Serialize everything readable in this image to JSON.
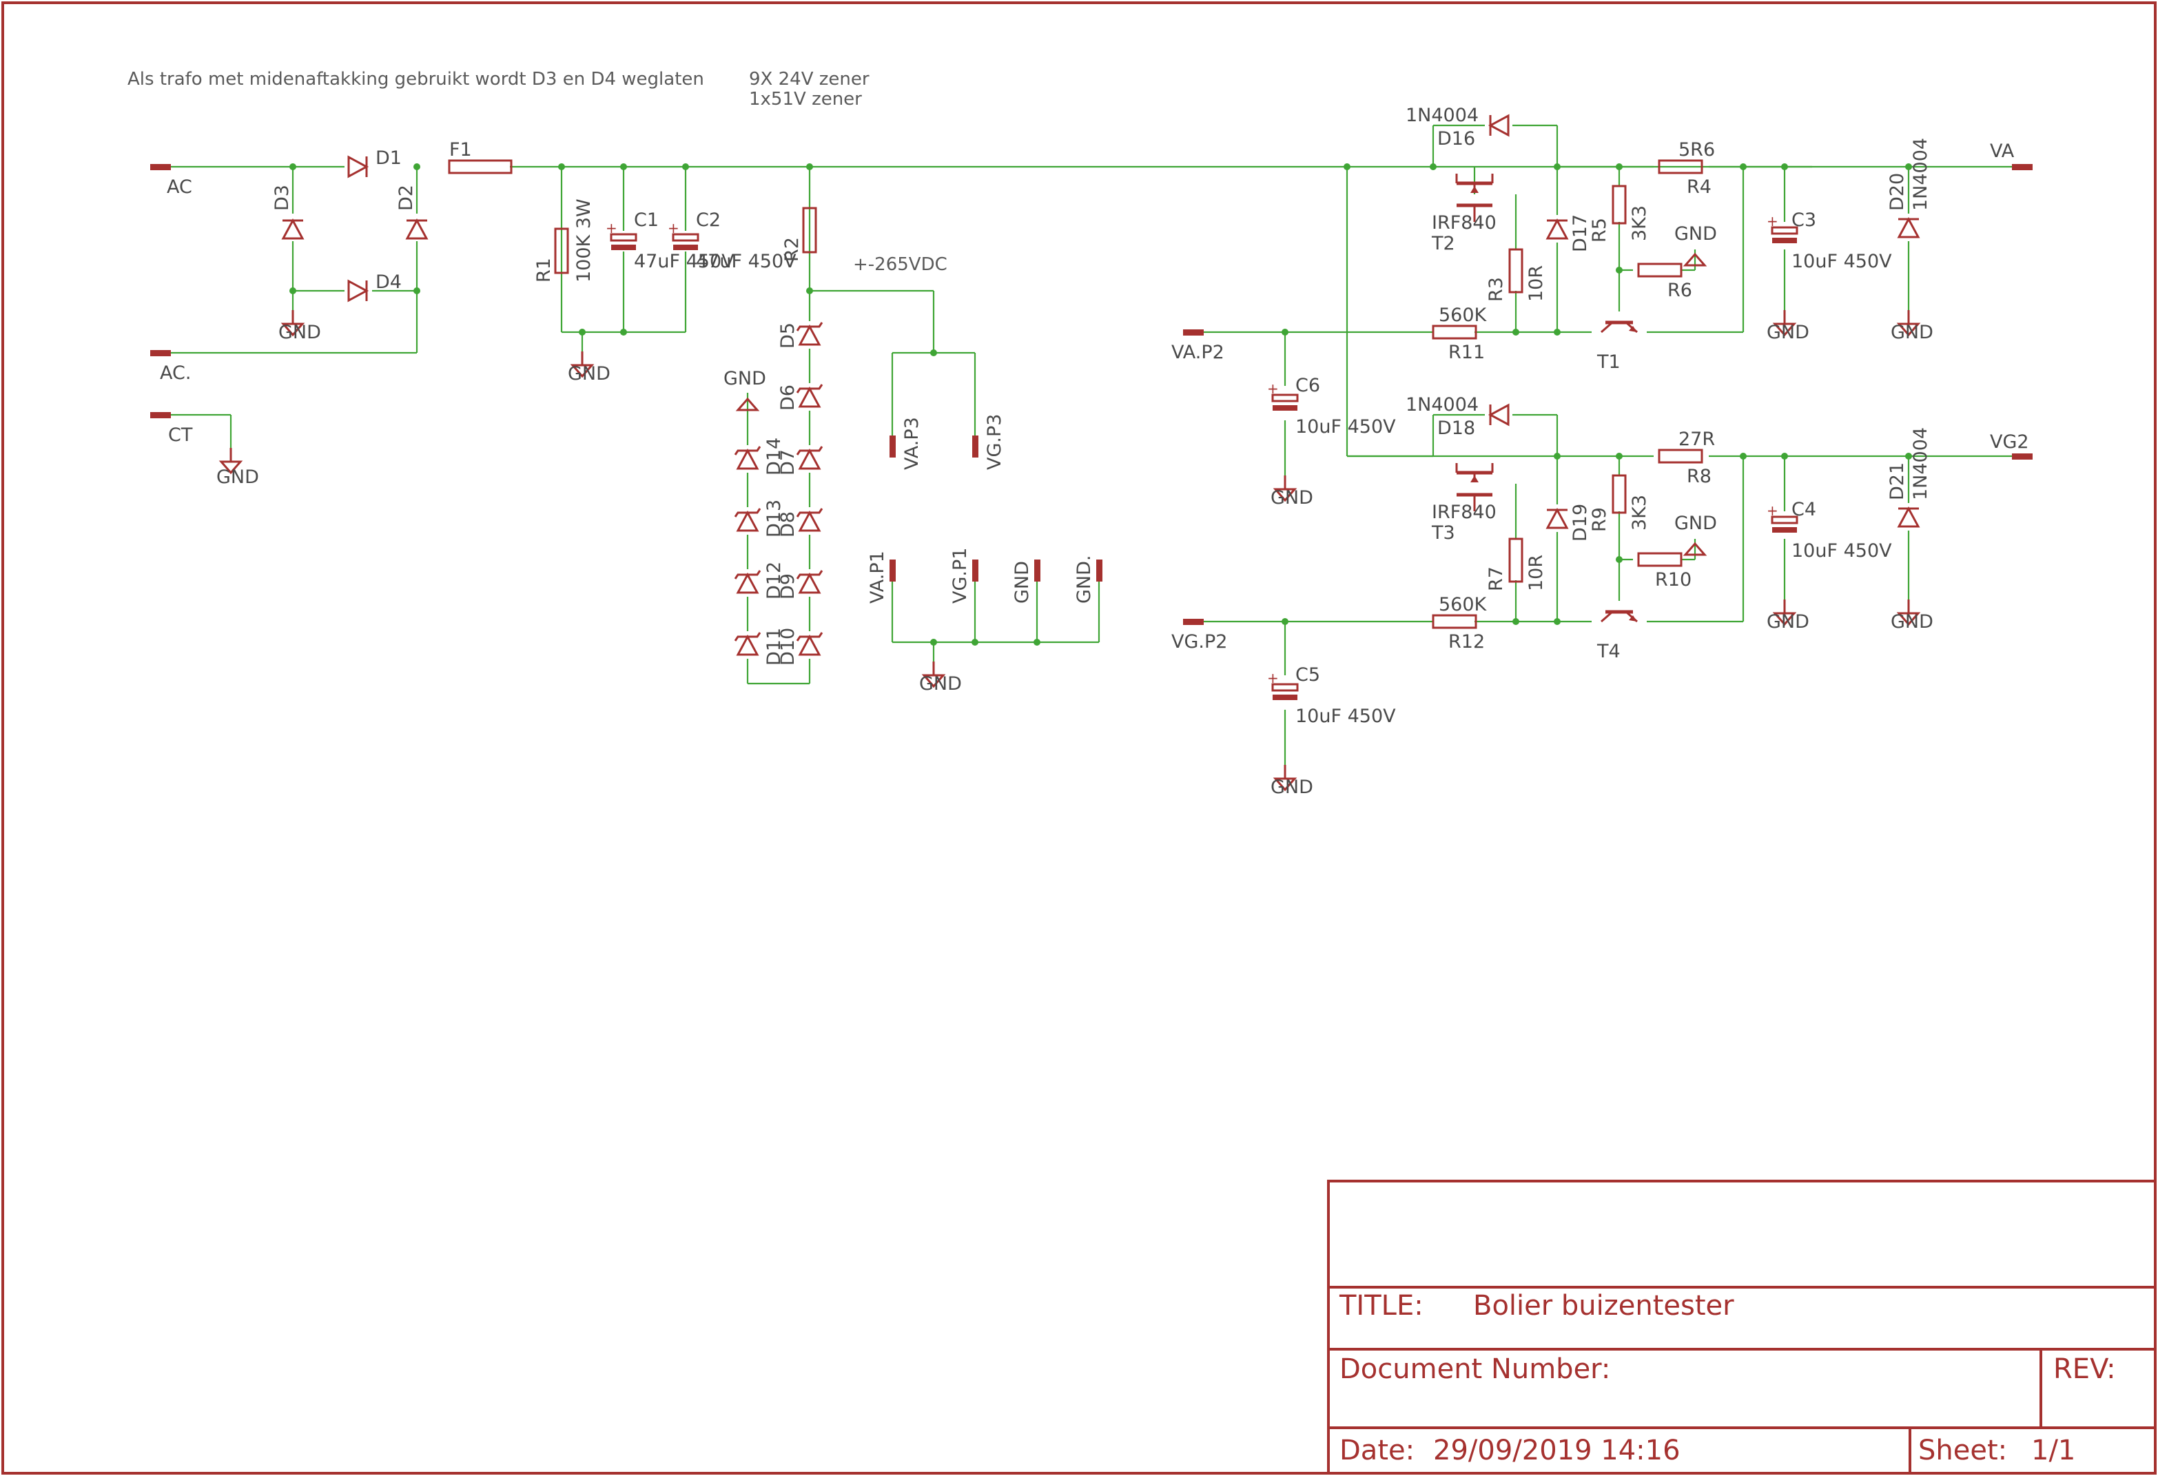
{
  "notes": {
    "center_tap": "Als trafo met midenaftakking gebruikt wordt D3 en D4 weglaten",
    "zener_line1": "9X 24V zener",
    "zener_line2": "1x51V zener",
    "voltage": "+-265VDC"
  },
  "ports": {
    "ac": "AC",
    "ac2": "AC.",
    "ct": "CT",
    "va": "VA",
    "vg2": "VG2",
    "vap2": "VA.P2",
    "vgp2": "VG.P2",
    "vap3": "VA.P3",
    "vgp3": "VG.P3",
    "vap1": "VA.P1",
    "vgp1": "VG.P1",
    "gndp": "GND",
    "gndp2": "GND."
  },
  "gnd": "GND",
  "parts": {
    "d1": "D1",
    "d2": "D2",
    "d3": "D3",
    "d4": "D4",
    "f1": "F1",
    "r1": "R1",
    "r1v": "100K 3W",
    "c1": "C1",
    "c1v": "47uF 450V",
    "c2": "C2",
    "c2v": "47uF 450V",
    "r2": "R2",
    "d5": "D5",
    "d6": "D6",
    "d7": "D7",
    "d8": "D8",
    "d9": "D9",
    "d10": "D10",
    "d11": "D11",
    "d12": "D12",
    "d13": "D13",
    "d14": "D14",
    "d16": "D16",
    "d16v": "1N4004",
    "t2": "T2",
    "t2v": "IRF840",
    "d17": "D17",
    "r3": "R3",
    "r3v": "10R",
    "r5": "R5",
    "r5v": "3K3",
    "r4": "R4",
    "r4v": "5R6",
    "r6": "R6",
    "r11": "R11",
    "r11v": "560K",
    "t1": "T1",
    "c3": "C3",
    "c3v": "10uF 450V",
    "d20": "D20",
    "d20v": "1N4004",
    "c6": "C6",
    "c6v": "10uF 450V",
    "d18": "D18",
    "d18v": "1N4004",
    "t3": "T3",
    "t3v": "IRF840",
    "d19": "D19",
    "r7": "R7",
    "r7v": "10R",
    "r9": "R9",
    "r9v": "3K3",
    "r8": "R8",
    "r8v": "27R",
    "r10": "R10",
    "r12": "R12",
    "r12v": "560K",
    "t4": "T4",
    "c4": "C4",
    "c4v": "10uF 450V",
    "d21": "D21",
    "d21v": "1N4004",
    "c5": "C5",
    "c5v": "10uF 450V"
  },
  "title_block": {
    "title_label": "TITLE:",
    "title": "Bolier buizentester",
    "doc_label": "Document Number:",
    "rev_label": "REV:",
    "date_label": "Date:",
    "date": "29/09/2019 14:16",
    "sheet_label": "Sheet:",
    "sheet": "1/1"
  },
  "colors": {
    "wire": "#3fa535",
    "symbol": "#a5312f",
    "text": "#4a4a4a"
  }
}
